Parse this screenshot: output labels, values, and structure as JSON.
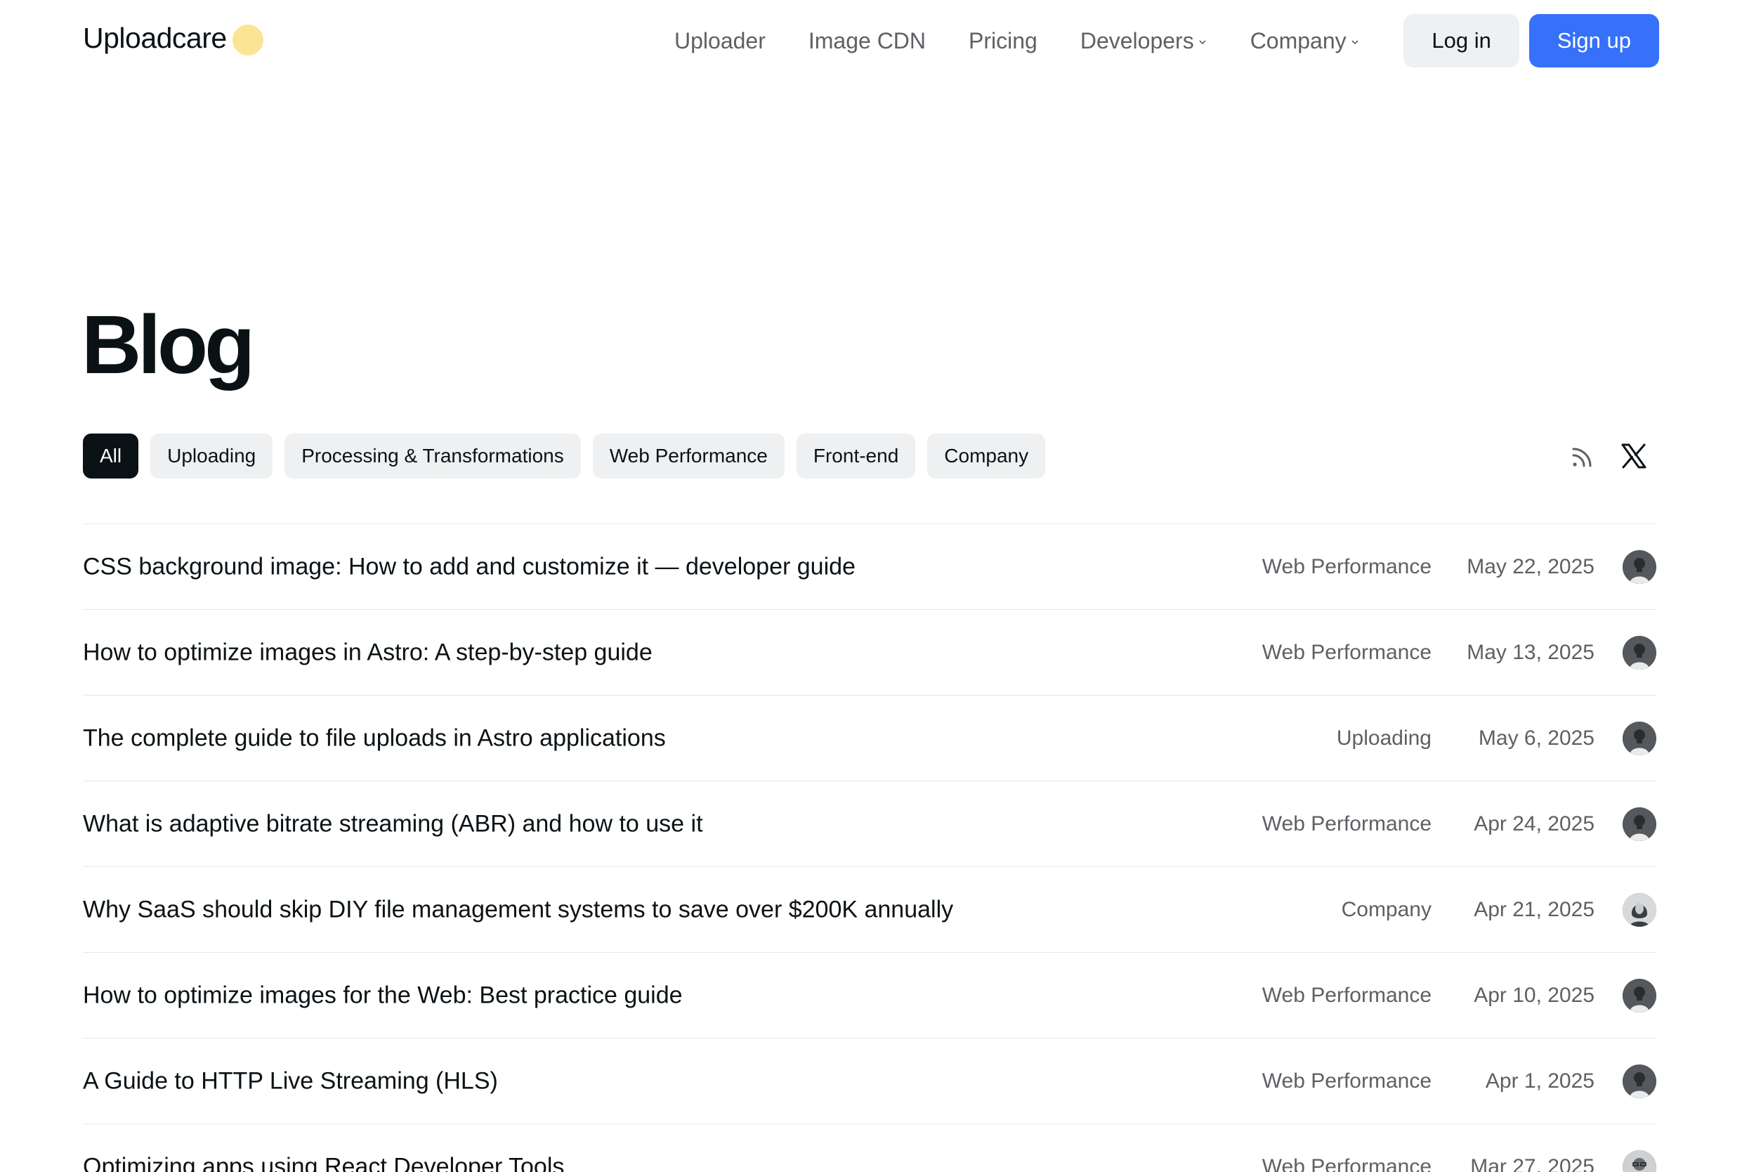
{
  "header": {
    "logo_text": "Uploadcare",
    "nav": [
      {
        "label": "Uploader",
        "has_dropdown": false
      },
      {
        "label": "Image CDN",
        "has_dropdown": false
      },
      {
        "label": "Pricing",
        "has_dropdown": false
      },
      {
        "label": "Developers",
        "has_dropdown": true
      },
      {
        "label": "Company",
        "has_dropdown": true
      }
    ],
    "login_label": "Log in",
    "signup_label": "Sign up"
  },
  "page": {
    "title": "Blog"
  },
  "filters": [
    {
      "label": "All",
      "active": true
    },
    {
      "label": "Uploading",
      "active": false
    },
    {
      "label": "Processing & Transformations",
      "active": false
    },
    {
      "label": "Web Performance",
      "active": false
    },
    {
      "label": "Front-end",
      "active": false
    },
    {
      "label": "Company",
      "active": false
    }
  ],
  "social": {
    "icons": [
      "rss-icon",
      "x-icon"
    ]
  },
  "posts": [
    {
      "title": "CSS background image: How to add and customize it — developer guide",
      "category": "Web Performance",
      "date": "May 22, 2025",
      "author_avatar": "man"
    },
    {
      "title": "How to optimize images in Astro: A step-by-step guide",
      "category": "Web Performance",
      "date": "May 13, 2025",
      "author_avatar": "man"
    },
    {
      "title": "The complete guide to file uploads in Astro applications",
      "category": "Uploading",
      "date": "May 6, 2025",
      "author_avatar": "man"
    },
    {
      "title": "What is adaptive bitrate streaming (ABR) and how to use it",
      "category": "Web Performance",
      "date": "Apr 24, 2025",
      "author_avatar": "man"
    },
    {
      "title": "Why SaaS should skip DIY file management systems to save over $200K annually",
      "category": "Company",
      "date": "Apr 21, 2025",
      "author_avatar": "woman"
    },
    {
      "title": "How to optimize images for the Web: Best practice guide",
      "category": "Web Performance",
      "date": "Apr 10, 2025",
      "author_avatar": "man"
    },
    {
      "title": "A Guide to HTTP Live Streaming (HLS)",
      "category": "Web Performance",
      "date": "Apr 1, 2025",
      "author_avatar": "man"
    },
    {
      "title": "Optimizing apps using React Developer Tools",
      "category": "Web Performance",
      "date": "Mar 27, 2025",
      "author_avatar": "man-glasses"
    }
  ],
  "colors": {
    "accent": "#3771fa",
    "logo_dot": "#fbe594",
    "chip_bg": "#eff0f1",
    "chip_active_bg": "#0b1215",
    "text_primary": "#0b1215",
    "text_muted": "#5d6064",
    "divider": "#e6e7e9"
  }
}
